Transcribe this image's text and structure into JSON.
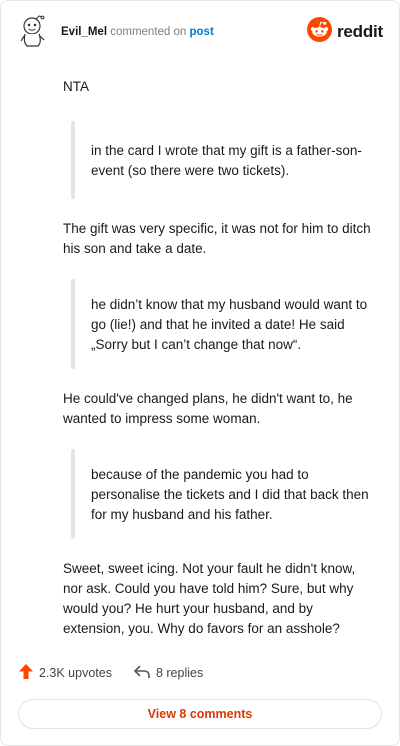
{
  "header": {
    "username": "Evil_Mel",
    "action_text": " commented on ",
    "post_link": "post",
    "brand": "reddit"
  },
  "comment": {
    "p1": "NTA",
    "q1": "in the card I wrote that my gift is a father-son-event (so there were two tickets).",
    "p2": "The gift was very specific, it was not for him to ditch his son and take a date.",
    "q2": "he didn’t know that my husband would want to go (lie!) and that he invited a date! He said „Sorry but I can’t change that now“.",
    "p3": "He could've changed plans, he didn't want to, he wanted to impress some woman.",
    "q3": "because of the pandemic you had to personalise the tickets and I did that back then for my husband and his father.",
    "p4": "Sweet, sweet icing. Not your fault he didn't know, nor ask. Could you have told him? Sure, but why would you? He hurt your husband, and by extension, you. Why do favors for an asshole?"
  },
  "footer": {
    "upvotes": "2.3K upvotes",
    "replies": "8 replies",
    "view_comments": "View 8 comments"
  },
  "colors": {
    "brand_orange": "#ff4500",
    "upvote_orange": "#ff4500",
    "link_blue": "#0079d3",
    "cta_text": "#d93a00"
  },
  "icons": {
    "avatar": "snoo-avatar-icon",
    "logo": "reddit-logo-icon",
    "upvote": "upvote-arrow-icon",
    "reply": "reply-arrow-icon"
  }
}
